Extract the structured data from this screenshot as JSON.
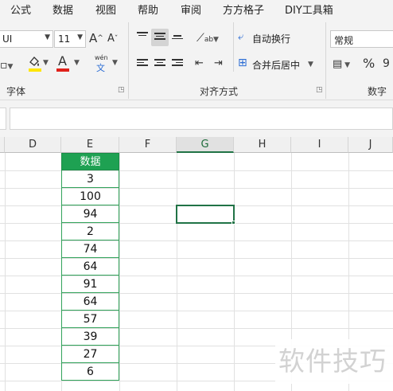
{
  "menu": {
    "items": [
      "公式",
      "数据",
      "视图",
      "帮助",
      "审阅",
      "方方格子",
      "DIY工具箱"
    ]
  },
  "ribbon": {
    "font_name_value": "UI",
    "font_size_value": "11",
    "grow_font_glyph": "A",
    "shrink_font_glyph": "A",
    "phonetic_label": "wén",
    "phonetic_char": "文",
    "font_color_glyph": "A",
    "font_group_label": "字体",
    "wrap_text_label": "自动换行",
    "merge_center_label": "合并后居中",
    "alignment_group_label": "对齐方式",
    "number_format_value": "常规",
    "percent_glyph": "%",
    "number_group_label": "数字",
    "colors": {
      "font_color_bar": "#e0211a",
      "highlight_bar": "#ffe600"
    }
  },
  "sheet": {
    "columns": [
      "D",
      "E",
      "F",
      "G",
      "H",
      "I",
      "J"
    ],
    "selected_column": "G",
    "header_cell": "数据",
    "values": [
      "3",
      "100",
      "94",
      "2",
      "74",
      "64",
      "91",
      "64",
      "57",
      "39",
      "27",
      "6"
    ],
    "colors": {
      "header_fill": "#1ea152",
      "border": "#31a35a",
      "active_cell": "#217346"
    }
  },
  "watermark": {
    "text": "软件技巧"
  }
}
